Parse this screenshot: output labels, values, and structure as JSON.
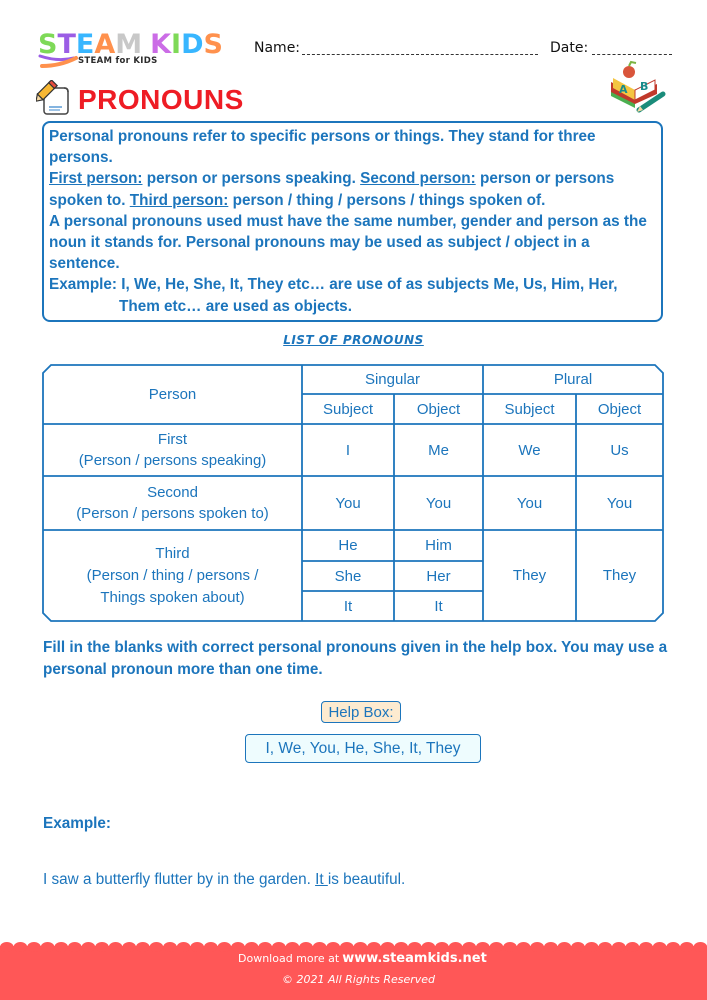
{
  "brand": {
    "logo_text": "STEAM KIDS",
    "logo_letter_colors": [
      "#7ed957",
      "#9b5de5",
      "#38b6ff",
      "#ff914d",
      "#c8c8c8",
      "#cb6ce6",
      "#7ed957",
      "#38b6ff",
      "#ff914d"
    ],
    "tagline": "STEAM for KIDS"
  },
  "header": {
    "name_label": "Name:",
    "date_label": "Date:"
  },
  "title": {
    "text": "PRONOUNS",
    "color": "#ee1c24",
    "icon": "pencil-paper-icon",
    "corner_icon": "abc-book-icon"
  },
  "intro": {
    "line1": "Personal pronouns refer to specific persons or things. They stand for three persons.",
    "first_person_label": "First person:",
    "first_person_text": " person or persons speaking. ",
    "second_person_label": "Second person:",
    "second_person_text": " person or persons spoken to. ",
    "third_person_label": "Third person:",
    "third_person_text": " person / thing / persons / things spoken of.",
    "rule": "A personal pronouns used must have the same number, gender and  person as the noun it stands for. Personal pronouns may be used as subject / object in a sentence.",
    "example_line1": "Example: I, We, He, She, It, They etc… are use of as subjects Me, Us, Him, Her,",
    "example_line2": "Them etc… are used as objects."
  },
  "pronoun_table": {
    "title": "LIST OF PRONOUNS",
    "header_person": "Person",
    "header_singular": "Singular",
    "header_plural": "Plural",
    "header_subject": "Subject",
    "header_object": "Object",
    "rows": [
      {
        "person": "First",
        "description": "(Person / persons speaking)",
        "sing_subject": "I",
        "sing_object": "Me",
        "plur_subject": "We",
        "plur_object": "Us"
      },
      {
        "person": "Second",
        "description": "(Person / persons spoken to)",
        "sing_subject": "You",
        "sing_object": "You",
        "plur_subject": "You",
        "plur_object": "You"
      },
      {
        "person": "Third",
        "description_line1": "(Person / thing / persons /",
        "description_line2": "Things spoken about)",
        "sing_subjects": [
          "He",
          "She",
          "It"
        ],
        "sing_objects": [
          "Him",
          "Her",
          "It"
        ],
        "plur_subject": "They",
        "plur_object": "They"
      }
    ]
  },
  "exercise": {
    "instructions": "Fill in the blanks with correct personal pronouns given in the help box. You may use a personal pronoun more than one time.",
    "help_box_label": "Help Box:",
    "help_box_words": "I, We, You, He, She, It, They",
    "example_label": "Example:",
    "example_before": "I saw a butterfly flutter by in the garden. ",
    "example_answer": "It ",
    "example_after": "is beautiful."
  },
  "footer": {
    "download_text": "Download more at",
    "site": "www.steamkids.net",
    "copyright": "©  2021 All Rights Reserved",
    "color": "#ff5757"
  },
  "theme": {
    "accent": "#1c75bc"
  }
}
